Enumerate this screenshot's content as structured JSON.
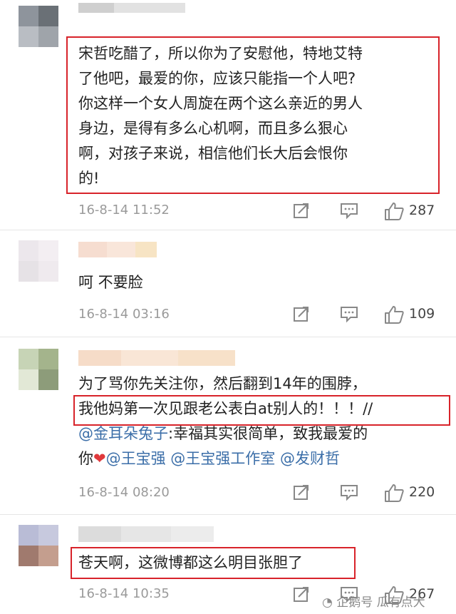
{
  "comments": [
    {
      "lines": [
        "宋哲吃醋了，所以你为了安慰他，特地艾特",
        "了他吧，最爱的你，应该只能指一个人吧?",
        "你这样一个女人周旋在两个这么亲近的男人",
        "身边，是得有多么心机啊，而且多么狠心",
        "啊，对孩子来说，相信他们长大后会恨你",
        "的!"
      ],
      "timestamp": "16-8-14 11:52",
      "likes": "287"
    },
    {
      "lines": [
        "呵 不要脸"
      ],
      "timestamp": "16-8-14 03:16",
      "likes": "109"
    },
    {
      "line1": "为了骂你先关注你，然后翻到14年的围脖，",
      "line2": "我他妈第一次见跟老公表白at别人的！！！//",
      "line3_mention": "@金耳朵兔子",
      "line3_rest": ":幸福其实很简单，致我最爱的",
      "line4_prefix": "你",
      "line4_heart": "❤",
      "line4_mentions": "@王宝强 @王宝强工作室 @发财哲",
      "timestamp": "16-8-14 08:20",
      "likes": "220"
    },
    {
      "lines": [
        "苍天啊，这微博都这么明目张胆了"
      ],
      "timestamp": "16-8-14 10:35",
      "likes": "267"
    }
  ],
  "watermark": "企鹅号 瓜有点大",
  "icons": {
    "share": "share-icon",
    "comment": "comment-icon",
    "like": "thumbs-up-icon"
  },
  "colors": {
    "highlight_border": "#d8232a",
    "mention": "#3b6ea8",
    "meta": "#9a9a9a"
  }
}
